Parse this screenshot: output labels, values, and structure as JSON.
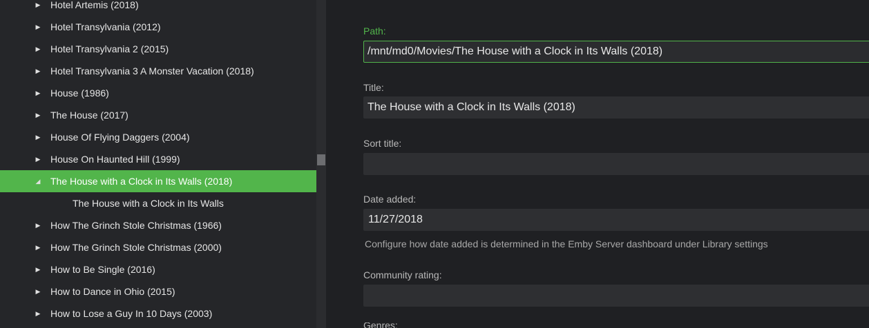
{
  "tree": {
    "items": [
      {
        "label": "Hotel Artemis (2018)"
      },
      {
        "label": "Hotel Transylvania (2012)"
      },
      {
        "label": "Hotel Transylvania 2 (2015)"
      },
      {
        "label": "Hotel Transylvania 3 A Monster Vacation (2018)"
      },
      {
        "label": "House (1986)"
      },
      {
        "label": "The House (2017)"
      },
      {
        "label": "House Of Flying Daggers (2004)"
      },
      {
        "label": "House On Haunted Hill (1999)"
      },
      {
        "label": "The House with a Clock in Its Walls (2018)"
      },
      {
        "label": "The House with a Clock in Its Walls"
      },
      {
        "label": "How The Grinch Stole Christmas (1966)"
      },
      {
        "label": "How The Grinch Stole Christmas (2000)"
      },
      {
        "label": "How to Be Single (2016)"
      },
      {
        "label": "How to Dance in Ohio (2015)"
      },
      {
        "label": "How to Lose a Guy In 10 Days (2003)"
      }
    ],
    "selected_index": 8
  },
  "icons": {
    "collapsed": "triangle-right-icon",
    "expanded": "triangle-down-right-icon"
  },
  "colors": {
    "accent": "#52b54b",
    "panel": "#252629",
    "background": "#1f2023"
  },
  "form": {
    "path": {
      "label": "Path:",
      "value": "/mnt/md0/Movies/The House with a Clock in Its Walls (2018)"
    },
    "title": {
      "label": "Title:",
      "value": "The House with a Clock in Its Walls (2018)"
    },
    "sort_title": {
      "label": "Sort title:",
      "value": ""
    },
    "date_added": {
      "label": "Date added:",
      "value": "11/27/2018",
      "description": "Configure how date added is determined in the Emby Server dashboard under Library settings"
    },
    "community_rating": {
      "label": "Community rating:",
      "value": ""
    },
    "next_label": "Genres:"
  }
}
